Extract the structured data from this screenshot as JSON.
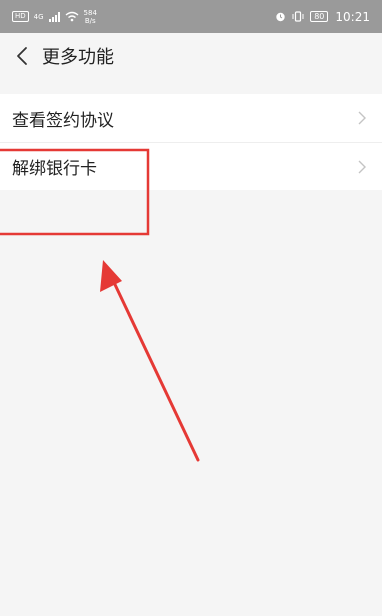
{
  "status_bar": {
    "network_badge": "HD",
    "signal_label": "4G",
    "speed_value": "584",
    "speed_unit": "B/s",
    "battery": "80",
    "time": "10:21"
  },
  "header": {
    "back_icon": "chevron-left-icon",
    "title": "更多功能"
  },
  "list": {
    "items": [
      {
        "label": "查看签约协议",
        "icon": "chevron-right-icon"
      },
      {
        "label": "解绑银行卡",
        "icon": "chevron-right-icon"
      }
    ]
  },
  "annotation": {
    "color": "#e53935"
  }
}
